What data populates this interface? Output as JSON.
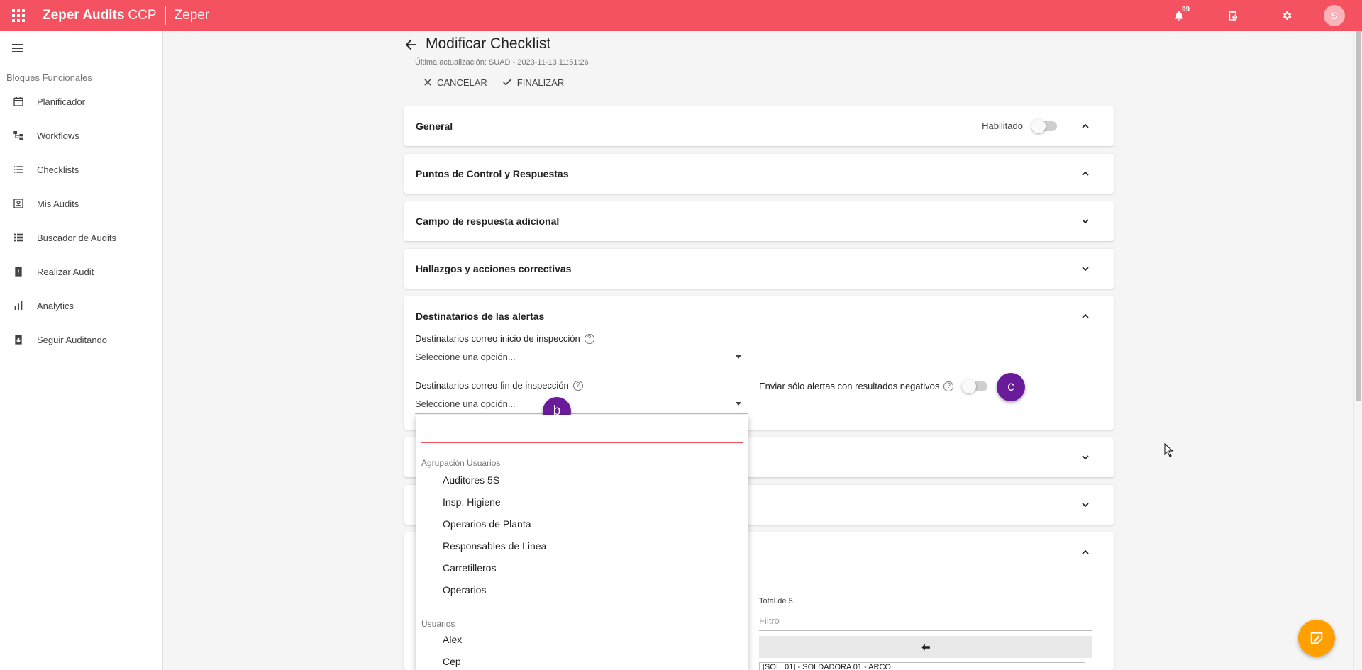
{
  "topbar": {
    "app_name": "Zeper Audits",
    "app_suffix": "CCP",
    "org": "Zeper",
    "notifications_count": "99",
    "avatar_letter": "S",
    "bar_color": "#f45260"
  },
  "sidebar": {
    "section": "Bloques Funcionales",
    "items": [
      {
        "label": "Planificador",
        "icon": "calendar-icon"
      },
      {
        "label": "Workflows",
        "icon": "workflow-icon"
      },
      {
        "label": "Checklists",
        "icon": "list-icon"
      },
      {
        "label": "Mis Audits",
        "icon": "contact-card-icon"
      },
      {
        "label": "Buscador de Audits",
        "icon": "view-list-icon"
      },
      {
        "label": "Realizar Audit",
        "icon": "clipboard-alert-icon"
      },
      {
        "label": "Analytics",
        "icon": "bar-chart-icon"
      },
      {
        "label": "Seguir Auditando",
        "icon": "clipboard-download-icon"
      }
    ]
  },
  "page": {
    "title": "Modificar Checklist",
    "updated": "Última actualización: SUAD - 2023-11-13 11:51:26",
    "cancel": "CANCELAR",
    "finish": "FINALIZAR"
  },
  "panels": {
    "general": "General",
    "general_toggle_label": "Habilitado",
    "general_enabled": false,
    "control_points": "Puntos de Control y Respuestas",
    "additional_field": "Campo de respuesta adicional",
    "findings": "Hallazgos y acciones correctivas",
    "alerts": "Destinatarios de las alertas"
  },
  "alerts": {
    "start_label": "Destinatarios correo inicio de inspección",
    "start_placeholder": "Seleccione una opción...",
    "end_label": "Destinatarios correo fin de inspección",
    "end_placeholder": "Seleccione una opción...",
    "negative_only_label": "Enviar sólo alertas con resultados negativos",
    "negative_only": false,
    "help_glyph": "?"
  },
  "markers": {
    "b": "b",
    "c": "c"
  },
  "dropdown": {
    "search_value": "",
    "groups": [
      {
        "label": "Agrupación Usuarios",
        "options": [
          "Auditores 5S",
          "Insp. Higiene",
          "Operarios de Planta",
          "Responsables de Linea",
          "Carretilleros",
          "Operarios"
        ]
      },
      {
        "label": "Usuarios",
        "options": [
          "Alex",
          "Cep"
        ]
      }
    ]
  },
  "assignment": {
    "total": "Total de 5",
    "filter_placeholder": "Filtro",
    "first_item": "[SOL_01] - SOLDADORA 01 - ARCO"
  }
}
